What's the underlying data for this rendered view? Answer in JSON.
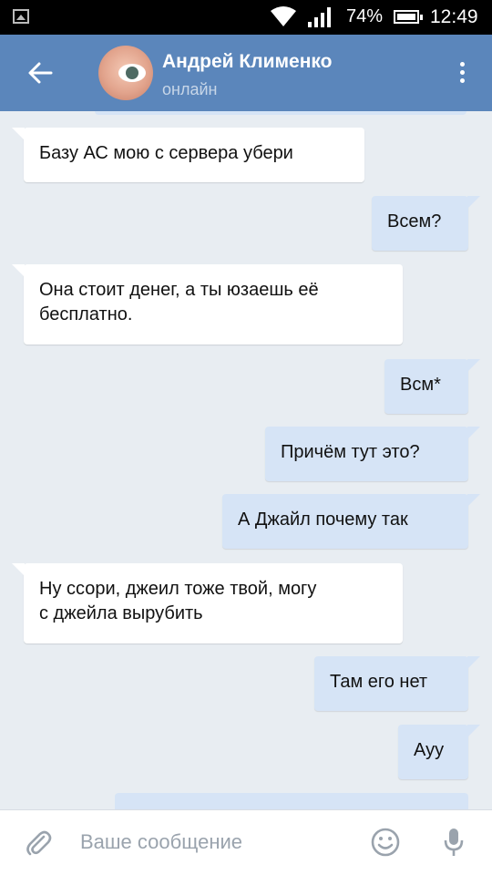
{
  "statusbar": {
    "battery": "74%",
    "time": "12:49",
    "icons": [
      "gallery-icon",
      "wifi-icon",
      "signal-icon",
      "battery-icon"
    ]
  },
  "header": {
    "name": "Андрей Клименко",
    "status": "онлайн",
    "icons": [
      "back-arrow-icon",
      "more-vert-icon"
    ]
  },
  "colors": {
    "appbar": "#5b86bb",
    "background": "#e8edf2",
    "incoming_bubble": "#ffffff",
    "outgoing_bubble": "#d6e4f6"
  },
  "messages": [
    {
      "dir": "in",
      "lines": [
        "Базу АС мою с сервера убери"
      ]
    },
    {
      "dir": "out",
      "lines": [
        "Всем?"
      ]
    },
    {
      "dir": "in",
      "lines": [
        "Она стоит денег, а ты юзаешь её",
        "бесплатно."
      ]
    },
    {
      "dir": "out",
      "lines": [
        "Всм*"
      ]
    },
    {
      "dir": "out",
      "lines": [
        "Причём тут это?"
      ]
    },
    {
      "dir": "out",
      "lines": [
        "А Джайл почему так"
      ]
    },
    {
      "dir": "in",
      "lines": [
        "Ну ссори, джеил тоже твой, могу",
        "с джейла вырубить"
      ]
    },
    {
      "dir": "out",
      "lines": [
        "Там его нет"
      ]
    },
    {
      "dir": "out",
      "lines": [
        "Ауу"
      ]
    }
  ],
  "composer": {
    "placeholder": "Ваше сообщение",
    "icons": [
      "attach-icon",
      "emoji-icon",
      "mic-icon"
    ]
  }
}
